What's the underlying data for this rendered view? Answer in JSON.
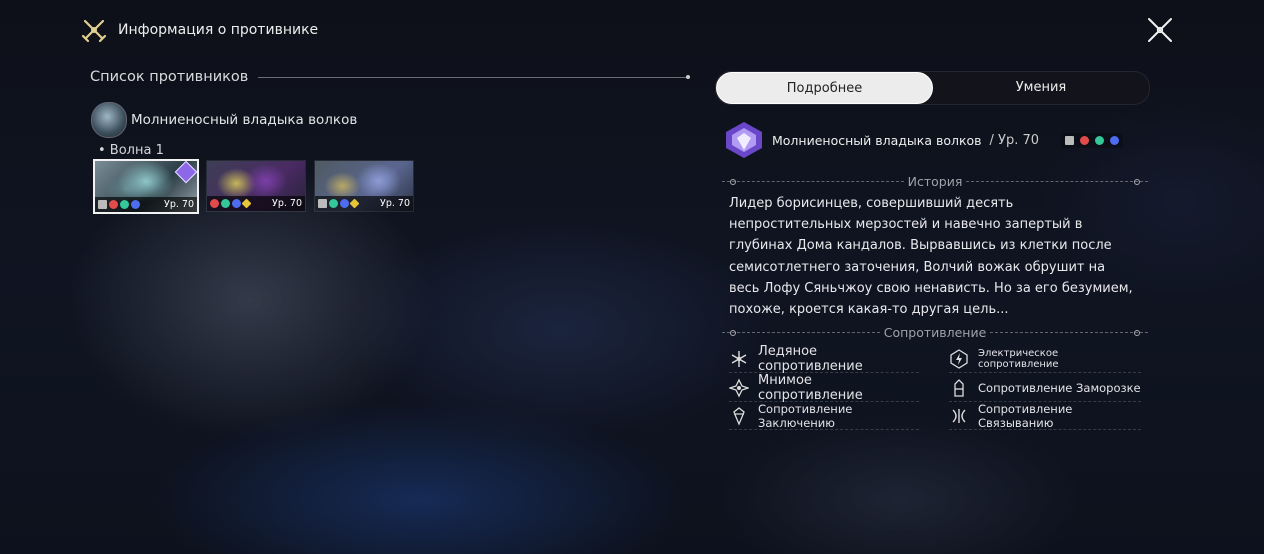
{
  "header": {
    "title": "Информация о противнике",
    "icon": "crossed-swords-icon"
  },
  "enemy_list": {
    "heading": "Список противников",
    "boss_name": "Молниеносный владыка волков",
    "wave_label": "• Волна 1",
    "cards": [
      {
        "level": "Ур. 70",
        "elements": [
          "physical",
          "fire",
          "wind",
          "lightning"
        ],
        "selected": true,
        "badge": "diamond-badge"
      },
      {
        "level": "Ур. 70",
        "elements": [
          "fire",
          "wind",
          "lightning",
          "imaginary"
        ],
        "selected": false
      },
      {
        "level": "Ур. 70",
        "elements": [
          "physical",
          "wind",
          "lightning",
          "imaginary"
        ],
        "selected": false
      }
    ]
  },
  "tabs": {
    "details": "Подробнее",
    "skills": "Умения",
    "active": "details"
  },
  "enemy": {
    "name": "Молниеносный владыка волков",
    "level": "/ Ур.  70",
    "weaknesses": [
      "physical",
      "fire",
      "wind",
      "lightning"
    ]
  },
  "story": {
    "title": "История",
    "text": "Лидер борисинцев, совершивший десять непростительных мерзостей и навечно запертый в глубинах Дома кандалов. Вырвавшись из клетки после семисотлетнего заточения, Волчий вожак обрушит на весь Лофу Сяньчжоу свою ненависть. Но за его безумием, похоже, кроется какая-то другая цель..."
  },
  "resistance": {
    "title": "Сопротивление",
    "items": [
      {
        "label": "Ледяное сопротивление",
        "icon": "ice-resistance-icon"
      },
      {
        "label": "Электрическое сопротивление",
        "icon": "lightning-resistance-icon"
      },
      {
        "label": "Мнимое сопротивление",
        "icon": "imaginary-resistance-icon"
      },
      {
        "label": "Сопротивление Заморозке",
        "icon": "freeze-resistance-icon"
      },
      {
        "label": "Сопротивление Заключению",
        "icon": "imprisonment-resistance-icon"
      },
      {
        "label": "Сопротивление Связыванию",
        "icon": "entanglement-resistance-icon"
      }
    ]
  },
  "colors": {
    "accent": "#8c68e8",
    "fire": "#e24b4b",
    "wind": "#34c79a",
    "lightning": "#4d6cf0",
    "imaginary": "#e6c636",
    "header_icon": "#e2cf8f"
  }
}
